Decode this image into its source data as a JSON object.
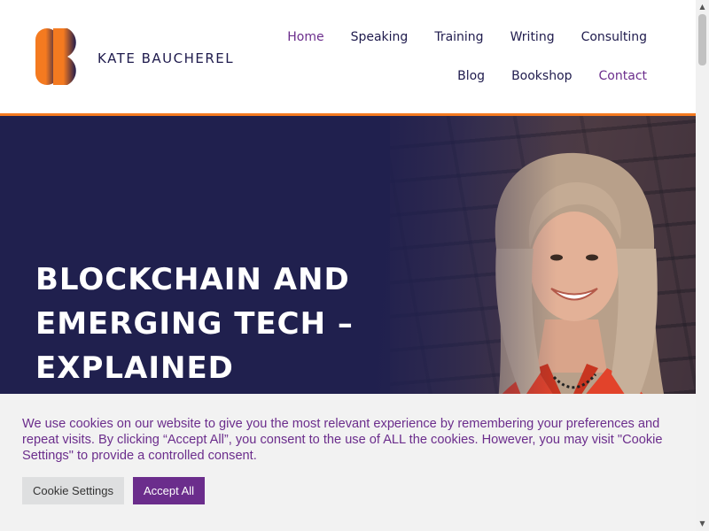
{
  "brand": {
    "name": "KATE BAUCHEREL",
    "colors": {
      "navy": "#20204e",
      "orange": "#f47a20",
      "purple": "#6b2d8c"
    }
  },
  "nav": {
    "row1": [
      "Home",
      "Speaking",
      "Training",
      "Writing",
      "Consulting"
    ],
    "row2": [
      "Blog",
      "Bookshop",
      "Contact"
    ],
    "active": "Home"
  },
  "hero": {
    "title_line1": "BLOCKCHAIN AND",
    "title_line2": "EMERGING TECH –",
    "title_line3": "EXPLAINED"
  },
  "cookie": {
    "message": "We use cookies on our website to give you the most relevant experience by remembering your preferences and repeat visits. By clicking “Accept All”, you consent to the use of ALL the cookies. However, you may visit \"Cookie Settings\" to provide a controlled consent.",
    "settings_label": "Cookie Settings",
    "accept_label": "Accept All"
  },
  "scrollbar": {
    "up_icon": "chevron-up-icon",
    "down_icon": "chevron-down-icon"
  }
}
